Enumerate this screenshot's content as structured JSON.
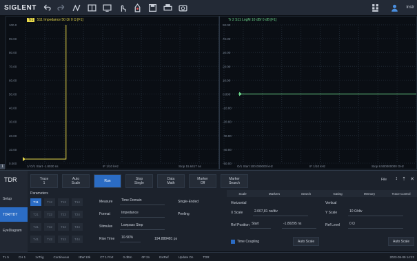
{
  "toolbar": {
    "logo": "SIGLENT",
    "user_label": "Instr"
  },
  "left_chart": {
    "badge": "Tr1",
    "title": "S11 Impedance 50 Ω/ 0 Ω [F1]",
    "y_ticks": [
      "100.0",
      "90.00",
      "80.00",
      "70.00",
      "60.00",
      "50.00",
      "40.00",
      "30.00",
      "20.00",
      "10.00",
      "0.000"
    ],
    "foot_start": "1/ O/1  Start  -1.8030 ns",
    "foot_mid": "IF 1/10 kHz",
    "foot_stop": "Stop 15.6417 ns",
    "marker_num": "1",
    "color": "#e8d94a"
  },
  "right_chart": {
    "title": "Tr 2   S11 LogM 10 dB/ 0 dB [F1]",
    "y_ticks": [
      "50.00",
      "40.00",
      "30.00",
      "20.00",
      "10.00",
      "0.000",
      "-10.00",
      "-20.00",
      "-30.00",
      "-40.00",
      "-50.00"
    ],
    "foot_start": "O/1  Start  100.000000 kHz",
    "foot_mid": "IF 1/10 kHz",
    "foot_stop": "Stop 8.500000000 GHz",
    "color": "#6edb8e"
  },
  "panel": {
    "tdr_label": "TDR",
    "side_buttons": [
      "Setup",
      "TDR/TDT",
      "EyeDiagram"
    ],
    "controls": [
      {
        "top": "Trace",
        "bottom": "1"
      },
      {
        "top": "Auto",
        "bottom": "Scale"
      },
      {
        "top": "Run",
        "bottom": ""
      },
      {
        "top": "Stop",
        "bottom": "Single"
      },
      {
        "top": "Data",
        "bottom": "Math"
      },
      {
        "top": "Marker",
        "bottom": "Off"
      },
      {
        "top": "Marker",
        "bottom": "Search"
      }
    ],
    "params_label": "Parameters",
    "sparams": [
      [
        "T11",
        "T12",
        "T13",
        "T14"
      ],
      [
        "T21",
        "T22",
        "T23",
        "T24"
      ],
      [
        "T31",
        "T32",
        "T33",
        "T34"
      ],
      [
        "T41",
        "T42",
        "T43",
        "T44"
      ]
    ],
    "rows": [
      {
        "label": "Measure",
        "value": "Time Domain",
        "value2": "Single-Ended"
      },
      {
        "label": "Format",
        "value": "Impedance",
        "value2": "Peeling"
      },
      {
        "label": "Stimulus",
        "value": "Lowpass Step",
        "value2": ""
      },
      {
        "label": "Rise Time",
        "value": "10-90%",
        "value2": "194.888481 ps"
      }
    ]
  },
  "right_panel": {
    "file_menu": "File",
    "tabs": [
      "Scale",
      "Markers",
      "Search",
      "Gating",
      "Memory",
      "Trace Control"
    ],
    "horizontal_title": "Horizontal",
    "vertical_title": "Vertical",
    "x_scale_label": "X Scale",
    "x_scale_value": "2.007,81 ns/div",
    "y_scale_label": "Y Scale",
    "y_scale_value": "10 Ω/div",
    "ref_pos_label": "Ref Position",
    "ref_pos_mode": "Start",
    "ref_pos_value": "-1.80295 ns",
    "ref_level_label": "Ref Level",
    "ref_level_value": "0 Ω",
    "time_coupling": "Time Coupling",
    "auto_scale": "Auto Scale",
    "auto_scale_2": "Auto Scale"
  },
  "status": {
    "items": [
      "TL 5",
      "CH 1",
      "1xTrig",
      "Continuous",
      "IBW 10k",
      "CT 1 Port",
      "0 dBm",
      "0P 2n",
      "ExtRef",
      "Update On",
      "TDR"
    ],
    "time": "2023-05-09 14:22"
  }
}
